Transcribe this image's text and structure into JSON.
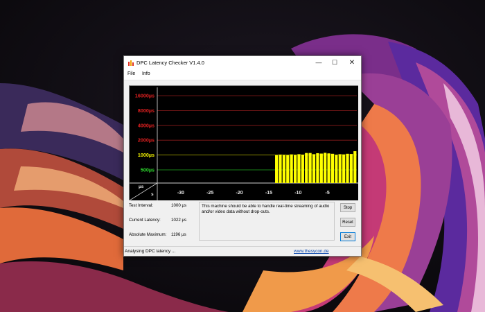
{
  "window": {
    "title": "DPC Latency Checker V1.4.0",
    "controls": {
      "minimize": "—",
      "maximize": "☐",
      "close": "✕"
    }
  },
  "menu": [
    "File",
    "Info"
  ],
  "chart_data": {
    "type": "bar",
    "y_labels": [
      {
        "text": "16000µs",
        "color": "#e02020",
        "line_color": "#8b1c1c",
        "level": 16000
      },
      {
        "text": "8000µs",
        "color": "#e02020",
        "line_color": "#8b1c1c",
        "level": 8000
      },
      {
        "text": "4000µs",
        "color": "#e02020",
        "line_color": "#8b1c1c",
        "level": 4000
      },
      {
        "text": "2000µs",
        "color": "#e02020",
        "line_color": "#8b1c1c",
        "level": 2000
      },
      {
        "text": "1000µs",
        "color": "#f0f000",
        "line_color": "#b8b800",
        "level": 1000
      },
      {
        "text": "500µs",
        "color": "#2ed82e",
        "line_color": "#22aa22",
        "level": 500
      }
    ],
    "axis_corner": {
      "y_unit": "µs",
      "x_unit": "s"
    },
    "x_ticks": [
      "-30",
      "-25",
      "-20",
      "-15",
      "-10",
      "-5"
    ],
    "x_tick_values": [
      -30,
      -25,
      -20,
      -15,
      -10,
      -5
    ],
    "x_range": [
      -34,
      0
    ],
    "y_scale": "log2",
    "bar_color": "#ffff00",
    "bar_values": [
      1000,
      1022,
      1010,
      1000,
      1030,
      1010,
      1040,
      1020,
      1100,
      1100,
      1040,
      1090,
      1070,
      1110,
      1080,
      1060,
      1010,
      1040,
      1030,
      1060,
      1050,
      1196
    ]
  },
  "stats": [
    {
      "label": "Test Interval:",
      "value": "1000 µs"
    },
    {
      "label": "Current Latency:",
      "value": "1022 µs"
    },
    {
      "label": "Absolute Maximum:",
      "value": "1196 µs"
    }
  ],
  "message": "This machine should be able to handle real-time streaming of audio and/or video data without drop-outs.",
  "buttons": {
    "stop": "Stop",
    "reset": "Reset",
    "exit": "Exit"
  },
  "status": {
    "text": "Analysing DPC latency ...",
    "link": "www.thesycon.de"
  }
}
